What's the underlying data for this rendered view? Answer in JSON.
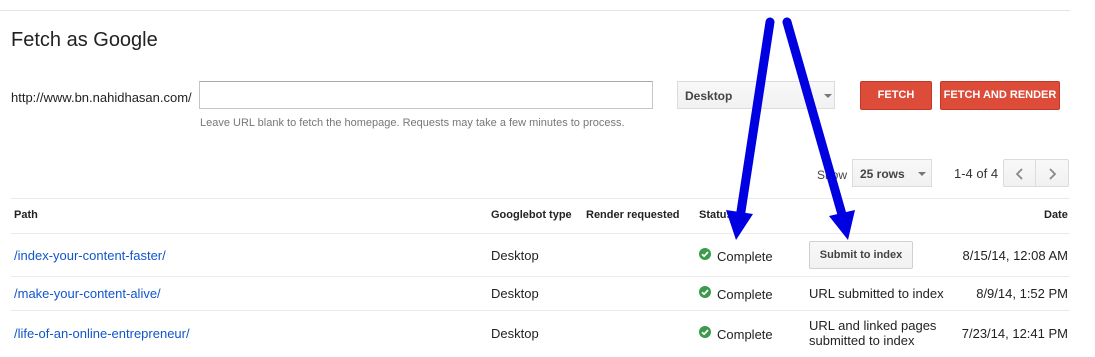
{
  "page_title": "Fetch as Google",
  "url_prefix": "http://www.bn.nahidhasan.com/",
  "url_input": {
    "value": "",
    "placeholder": ""
  },
  "hint": "Leave URL blank to fetch the homepage. Requests may take a few minutes to process.",
  "device_select": {
    "selected": "Desktop"
  },
  "buttons": {
    "fetch": "FETCH",
    "fetch_and_render": "FETCH AND RENDER"
  },
  "pagination": {
    "show_label": "Show",
    "rows_selected": "25 rows",
    "range": "1-4 of 4"
  },
  "table": {
    "headers": {
      "path": "Path",
      "googlebot_type": "Googlebot type",
      "render_requested": "Render requested",
      "status": "Status",
      "date": "Date"
    },
    "rows": [
      {
        "path": "/index-your-content-faster/",
        "googlebot_type": "Desktop",
        "status": "Complete",
        "action": "Submit to index",
        "date": "8/15/14, 12:08 AM"
      },
      {
        "path": "/make-your-content-alive/",
        "googlebot_type": "Desktop",
        "status": "Complete",
        "action": "URL submitted to index",
        "date": "8/9/14, 1:52 PM"
      },
      {
        "path": "/life-of-an-online-entrepreneur/",
        "googlebot_type": "Desktop",
        "status": "Complete",
        "action_line1": "URL and linked pages",
        "action_line2": "submitted to index",
        "date": "7/23/14, 12:41 PM"
      }
    ]
  },
  "icons": {
    "status_ok": "check-circle-icon",
    "prev": "chevron-left-icon",
    "next": "chevron-right-icon",
    "dropdown": "caret-down-icon"
  },
  "colors": {
    "red_button": "#dd4b39",
    "link": "#1155cc",
    "status_green": "#3c9a4c",
    "annotation_arrow": "#0000e0"
  }
}
